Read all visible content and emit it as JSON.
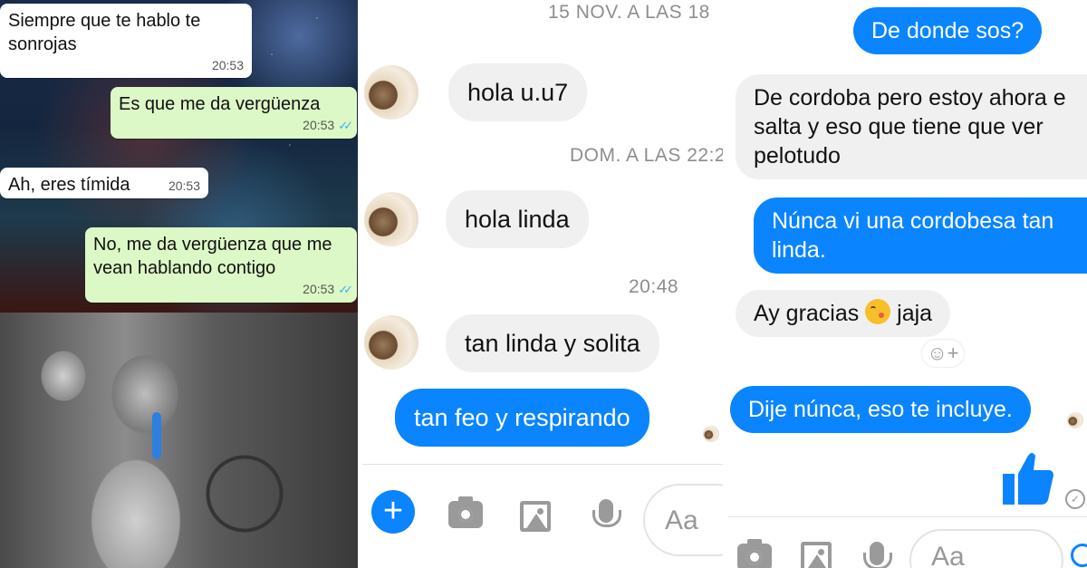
{
  "panel1": {
    "messages": [
      {
        "text": "Siempre que te hablo te sonrojas",
        "time": "20:53"
      },
      {
        "text": "Es que me da vergüenza",
        "time": "20:53"
      },
      {
        "text": "Ah, eres tímida",
        "time": "20:53"
      },
      {
        "text": "No, me da vergüenza que me vean hablando contigo",
        "time": "20:53"
      }
    ]
  },
  "panel2": {
    "dates": [
      "15 NOV. A LAS 18",
      "DOM. A LAS 22:2",
      "20:48"
    ],
    "messages": [
      {
        "text": "hola u.u7",
        "dir": "in"
      },
      {
        "text": "hola linda",
        "dir": "in"
      },
      {
        "text": "tan linda y solita",
        "dir": "in"
      },
      {
        "text": "tan feo y respirando",
        "dir": "out"
      }
    ],
    "composer_placeholder": "Aa",
    "plus_label": "+"
  },
  "panel3": {
    "messages": [
      {
        "text": "De donde sos?",
        "dir": "out"
      },
      {
        "text": "De cordoba pero estoy ahora e salta y eso que tiene que ver pelotudo",
        "dir": "in"
      },
      {
        "text": "Núnca vi una cordobesa tan linda.",
        "dir": "out"
      },
      {
        "text_before": "Ay gracias",
        "text_after": "jaja",
        "dir": "in"
      },
      {
        "text": "Dije núnca, eso te incluye.",
        "dir": "out"
      }
    ],
    "composer_placeholder": "Aa",
    "react_label": "☺+"
  },
  "colors": {
    "messenger_blue": "#0a84ff",
    "whatsapp_out": "#dcf8c6",
    "ticks": "#34b7f1"
  }
}
